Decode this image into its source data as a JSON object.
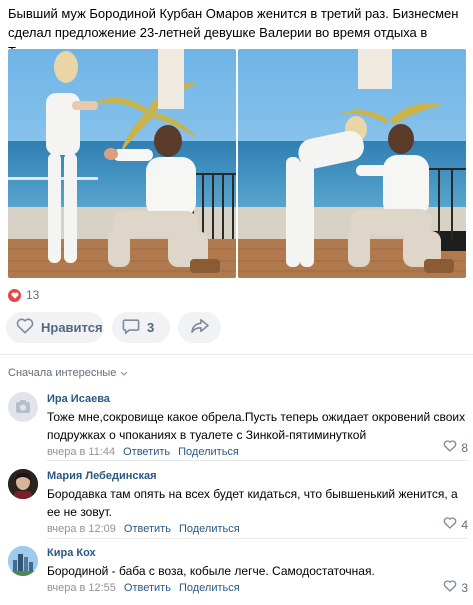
{
  "post": {
    "text": "Бывший муж Бородиной Курбан Омаров женится в третий раз. Бизнесмен сделал предложение 23-летней девушке Валерии во время отдыха в Таиланде."
  },
  "likes": {
    "count": "13"
  },
  "actions": {
    "like_label": "Нравится",
    "comment_count": "3"
  },
  "comments_sort": "Сначала интересные",
  "comments": [
    {
      "name": "Ира Исаева",
      "text": "Тоже мне,сокровище какое обрела.Пусть теперь ожидает окровений своих подружках о чпоканиях в туалете с Зинкой-пятиминуткой",
      "time": "вчера в 11:44",
      "reply": "Ответить",
      "share": "Поделиться",
      "likes": "8"
    },
    {
      "name": "Мария Лебединская",
      "text": "Бородавка там опять на всех будет кидаться, что бывшенький женится, а ее не зовут.",
      "time": "вчера в 12:09",
      "reply": "Ответить",
      "share": "Поделиться",
      "likes": "4"
    },
    {
      "name": "Кира Кох",
      "text": "Бородиной - баба с воза, кобыле легче. Самодостаточная.",
      "time": "вчера в 12:55",
      "reply": "Ответить",
      "share": "Поделиться",
      "likes": "3"
    }
  ],
  "colors": {
    "link": "#2a5885",
    "muted": "#626d7a",
    "like_red": "#e64646",
    "button_bg": "#f0f2f5"
  }
}
